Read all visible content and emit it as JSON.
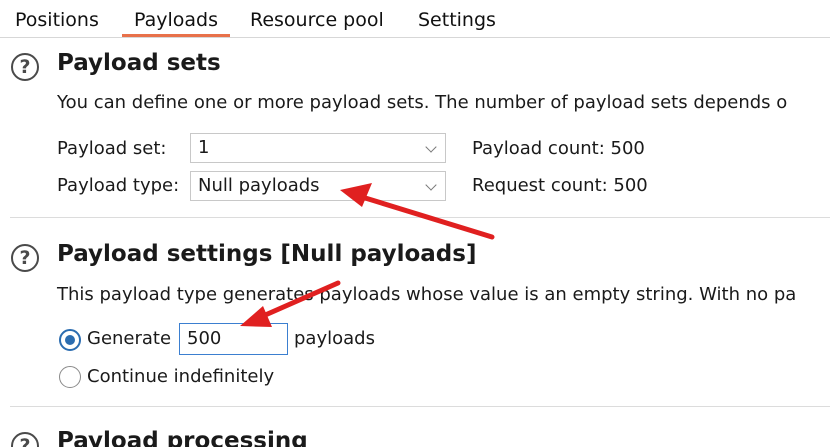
{
  "tabs": {
    "positions": "Positions",
    "payloads": "Payloads",
    "resource_pool": "Resource pool",
    "settings": "Settings"
  },
  "payload_sets": {
    "title": "Payload sets",
    "description": "You can define one or more payload sets. The number of payload sets depends o",
    "payload_set_label": "Payload set:",
    "payload_set_value": "1",
    "payload_type_label": "Payload type:",
    "payload_type_value": "Null payloads",
    "payload_count": "Payload count: 500",
    "request_count": "Request count: 500"
  },
  "payload_settings": {
    "title": "Payload settings [Null payloads]",
    "description": "This payload type generates payloads whose value is an empty string. With no pa",
    "generate_label": "Generate",
    "generate_value": "500",
    "payloads_suffix": "payloads",
    "continue_label": "Continue indefinitely",
    "selected_option": "Generate"
  },
  "payload_processing": {
    "title": "Payload processing"
  },
  "icons": {
    "help": "?"
  },
  "colors": {
    "active_tab_underline": "#e8714a",
    "radio_accent": "#2b6cb0",
    "annotation_arrow": "#e02020"
  }
}
